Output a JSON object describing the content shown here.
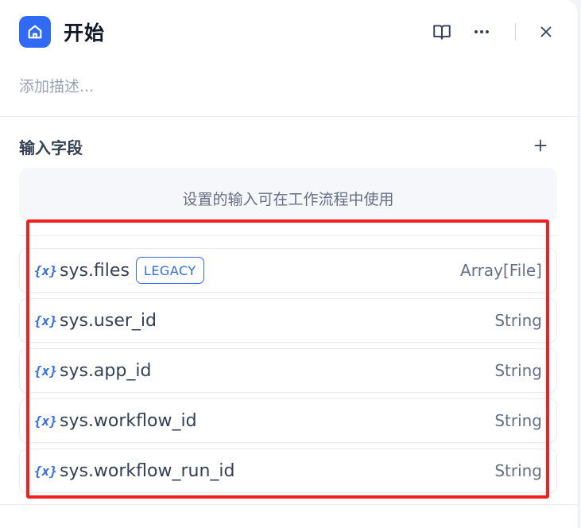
{
  "header": {
    "title": "开始",
    "icons": [
      "home-icon",
      "book-icon",
      "more-icon",
      "close-icon"
    ]
  },
  "description_placeholder": "添加描述...",
  "input_fields": {
    "section_title": "输入字段",
    "add_icon": "plus-icon",
    "hint": "设置的输入可在工作流程中使用",
    "variables": [
      {
        "icon": "{x}",
        "name": "sys.files",
        "badge": "LEGACY",
        "type": "Array[File]"
      },
      {
        "icon": "{x}",
        "name": "sys.user_id",
        "type": "String"
      },
      {
        "icon": "{x}",
        "name": "sys.app_id",
        "type": "String"
      },
      {
        "icon": "{x}",
        "name": "sys.workflow_id",
        "type": "String"
      },
      {
        "icon": "{x}",
        "name": "sys.workflow_run_id",
        "type": "String"
      }
    ]
  },
  "colors": {
    "accent": "#2f6bf6",
    "highlight": "#f31f1f"
  }
}
